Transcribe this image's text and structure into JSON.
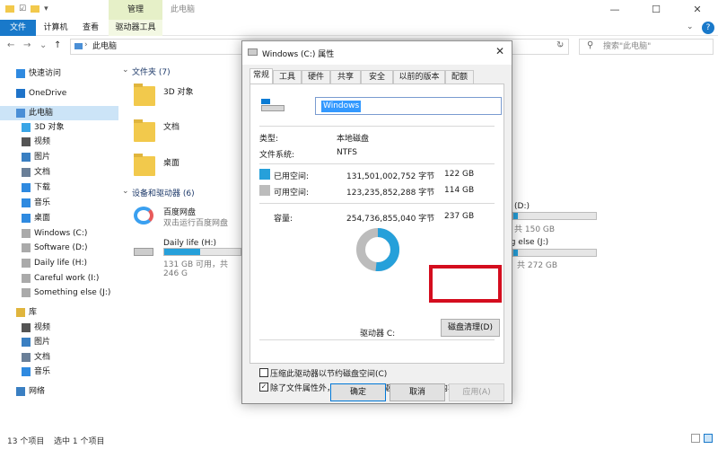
{
  "titlebar": {
    "context_tab": "管理",
    "title": "此电脑"
  },
  "ribbon": {
    "tabs": [
      "文件",
      "计算机",
      "查看",
      "驱动器工具"
    ]
  },
  "address": {
    "path": "此电脑",
    "search_placeholder": "搜索\"此电脑\""
  },
  "nav": {
    "items": [
      {
        "label": "快速访问",
        "icon": "star-icon"
      },
      {
        "label": "OneDrive",
        "icon": "cloud-icon"
      },
      {
        "label": "此电脑",
        "icon": "computer-icon",
        "selected": true
      },
      {
        "label": "3D 对象",
        "icon": "cube-icon"
      },
      {
        "label": "视频",
        "icon": "video-icon"
      },
      {
        "label": "图片",
        "icon": "picture-icon"
      },
      {
        "label": "文档",
        "icon": "document-icon"
      },
      {
        "label": "下载",
        "icon": "download-icon"
      },
      {
        "label": "音乐",
        "icon": "music-icon"
      },
      {
        "label": "桌面",
        "icon": "desktop-icon"
      },
      {
        "label": "Windows (C:)",
        "icon": "drive-icon"
      },
      {
        "label": "Software (D:)",
        "icon": "drive-icon"
      },
      {
        "label": "Daily life (H:)",
        "icon": "drive-icon"
      },
      {
        "label": "Careful work (I:)",
        "icon": "drive-icon"
      },
      {
        "label": "Something else (J:)",
        "icon": "drive-icon"
      },
      {
        "label": "库",
        "icon": "library-icon"
      },
      {
        "label": "视频",
        "icon": "video-icon"
      },
      {
        "label": "图片",
        "icon": "picture-icon"
      },
      {
        "label": "文档",
        "icon": "document-icon"
      },
      {
        "label": "音乐",
        "icon": "music-icon"
      },
      {
        "label": "网络",
        "icon": "network-icon"
      }
    ]
  },
  "content": {
    "folders_header": "文件夹 (7)",
    "folders": [
      "3D 对象",
      "文档",
      "桌面"
    ],
    "devices_header": "设备和驱动器 (6)",
    "baidu": {
      "name": "百度网盘",
      "sub": "双击运行百度网盘"
    },
    "drive_h": {
      "name": "Daily life (H:)",
      "sub": "131 GB 可用，共 246 G",
      "used_fraction": 0.47
    },
    "drive_d": {
      "name": "(D:)",
      "sub": "共 150 GB",
      "used_fraction": 0.05
    },
    "drive_j": {
      "name": "ng else (J:)",
      "sub": "，共 272 GB",
      "used_fraction": 0.05
    }
  },
  "status": {
    "count": "13 个项目",
    "selected": "选中 1 个项目"
  },
  "dialog": {
    "title": "Windows (C:) 属性",
    "tabs": [
      "常规",
      "工具",
      "硬件",
      "共享",
      "安全",
      "以前的版本",
      "配额"
    ],
    "name_value": "Windows",
    "type_label": "类型:",
    "type_value": "本地磁盘",
    "fs_label": "文件系统:",
    "fs_value": "NTFS",
    "used_label": "已用空间:",
    "used_bytes": "131,501,002,752 字节",
    "used_gb": "122 GB",
    "free_label": "可用空间:",
    "free_bytes": "123,235,852,288 字节",
    "free_gb": "114 GB",
    "cap_label": "容量:",
    "cap_bytes": "254,736,855,040 字节",
    "cap_gb": "237 GB",
    "used_fraction": 0.516,
    "drive_label": "驱动器 C:",
    "cleanup_button": "磁盘清理(D)",
    "compress_label": "压缩此驱动器以节约磁盘空间(C)",
    "compress_checked": false,
    "index_label": "除了文件属性外，还允许索引此驱动器上文件的内容(I)",
    "index_checked": true,
    "ok": "确定",
    "cancel": "取消",
    "apply": "应用(A)"
  },
  "colors": {
    "accent": "#1979ca",
    "used": "#26a0da",
    "free": "#bcbcbc",
    "highlight": "#d40d1e"
  }
}
